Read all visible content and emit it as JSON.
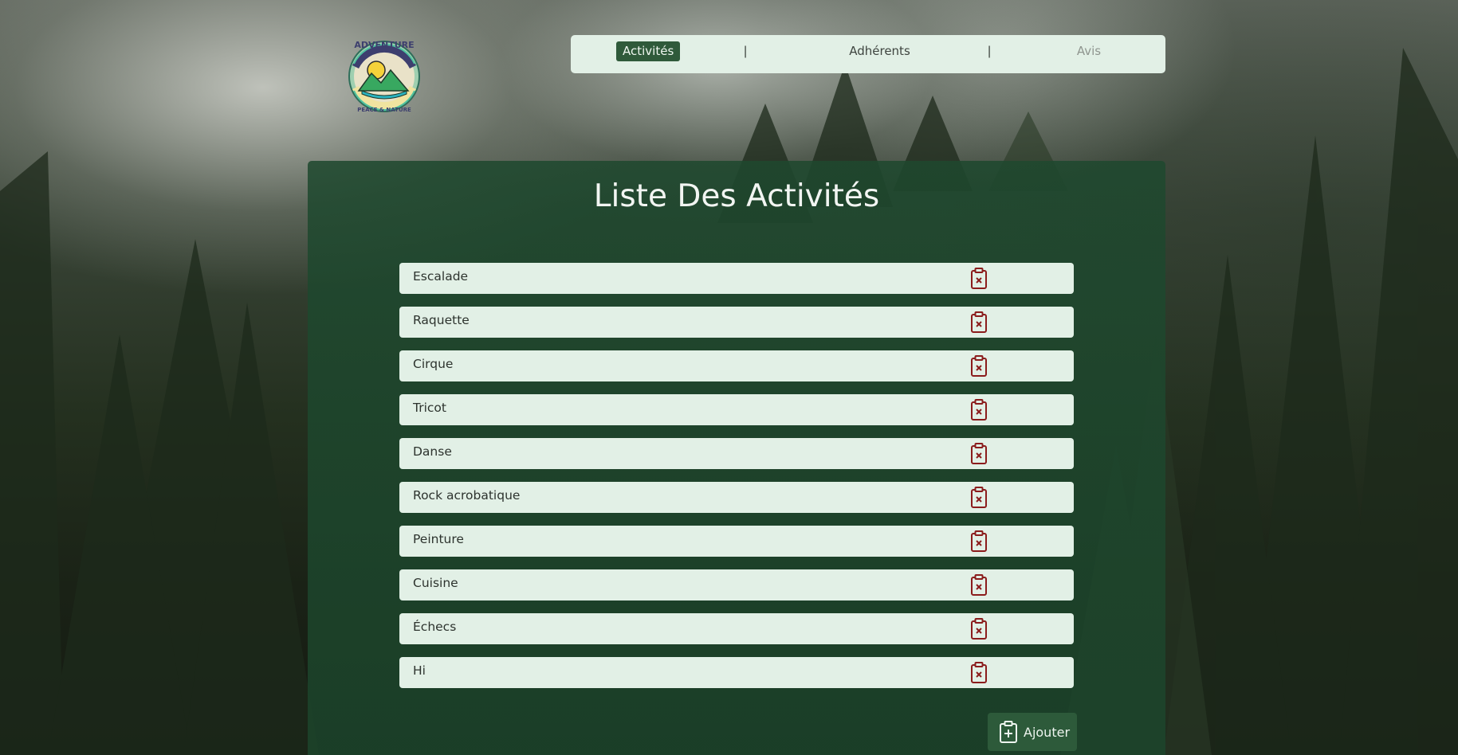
{
  "logo": {
    "top_text": "ADVENTURE",
    "bottom_text": "PEACE & NATURE"
  },
  "nav": {
    "items": [
      {
        "label": "Activités",
        "state": "active"
      },
      {
        "label": "Adhérents",
        "state": "default"
      },
      {
        "label": "Avis",
        "state": "muted"
      }
    ],
    "separator": "|"
  },
  "main": {
    "title": "Liste Des Activités",
    "activities": [
      {
        "name": "Escalade"
      },
      {
        "name": "Raquette"
      },
      {
        "name": "Cirque"
      },
      {
        "name": "Tricot"
      },
      {
        "name": "Danse"
      },
      {
        "name": "Rock acrobatique"
      },
      {
        "name": "Peinture"
      },
      {
        "name": "Cuisine"
      },
      {
        "name": "Échecs"
      },
      {
        "name": "Hi"
      }
    ],
    "delete_icon": "clipboard-x-icon",
    "add_button": {
      "label": "Ajouter",
      "icon": "clipboard-plus-icon"
    }
  },
  "colors": {
    "accent": "#2f5a3a",
    "row_background": "#e2f0e6",
    "delete_icon": "#8b1c1c"
  }
}
